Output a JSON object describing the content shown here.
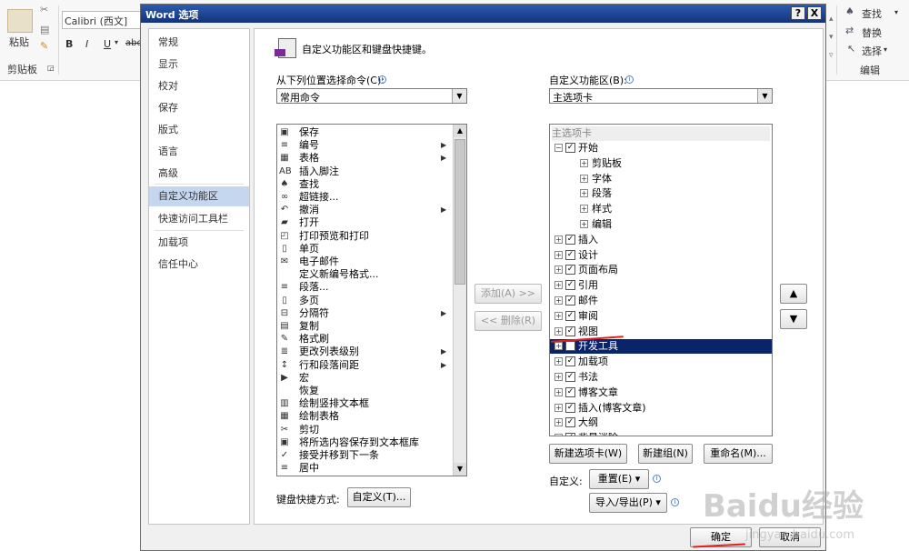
{
  "ribbon": {
    "paste_label": "粘贴",
    "clipboard_label": "剪贴板",
    "font_name": "Calibri (西文]",
    "bold": "B",
    "italic": "I",
    "underline": "U",
    "find_label": "查找",
    "replace_label": "替换",
    "select_label": "选择",
    "editing_label": "编辑"
  },
  "dialog": {
    "title": "Word 选项",
    "help_btn": "?",
    "close_btn": "X"
  },
  "nav": {
    "items": [
      "常规",
      "显示",
      "校对",
      "保存",
      "版式",
      "语言",
      "高级",
      "自定义功能区",
      "快速访问工具栏",
      "加载项",
      "信任中心"
    ],
    "selected": "自定义功能区"
  },
  "main": {
    "heading": "自定义功能区和键盘快捷键。",
    "left_label": "从下列位置选择命令(C):",
    "left_combo": "常用命令",
    "right_label": "自定义功能区(B):",
    "right_combo": "主选项卡",
    "commands": [
      {
        "icon": "▣",
        "label": "保存",
        "sub": ""
      },
      {
        "icon": "≡",
        "label": "编号",
        "sub": "▶"
      },
      {
        "icon": "▦",
        "label": "表格",
        "sub": "▶"
      },
      {
        "icon": "AB",
        "label": "插入脚注",
        "sub": ""
      },
      {
        "icon": "♠",
        "label": "查找",
        "sub": ""
      },
      {
        "icon": "∞",
        "label": "超链接...",
        "sub": ""
      },
      {
        "icon": "↶",
        "label": "撤消",
        "sub": "▶"
      },
      {
        "icon": "▰",
        "label": "打开",
        "sub": ""
      },
      {
        "icon": "◰",
        "label": "打印预览和打印",
        "sub": ""
      },
      {
        "icon": "▯",
        "label": "单页",
        "sub": ""
      },
      {
        "icon": "✉",
        "label": "电子邮件",
        "sub": ""
      },
      {
        "icon": "",
        "label": "定义新编号格式...",
        "sub": ""
      },
      {
        "icon": "≡",
        "label": "段落...",
        "sub": ""
      },
      {
        "icon": "▯",
        "label": "多页",
        "sub": ""
      },
      {
        "icon": "⊟",
        "label": "分隔符",
        "sub": "▶"
      },
      {
        "icon": "▤",
        "label": "复制",
        "sub": ""
      },
      {
        "icon": "✎",
        "label": "格式刷",
        "sub": ""
      },
      {
        "icon": "≣",
        "label": "更改列表级别",
        "sub": "▶"
      },
      {
        "icon": "↕",
        "label": "行和段落间距",
        "sub": "▶"
      },
      {
        "icon": "▶",
        "label": "宏",
        "sub": ""
      },
      {
        "icon": "",
        "label": "恢复",
        "sub": ""
      },
      {
        "icon": "▥",
        "label": "绘制竖排文本框",
        "sub": ""
      },
      {
        "icon": "▦",
        "label": "绘制表格",
        "sub": ""
      },
      {
        "icon": "✂",
        "label": "剪切",
        "sub": ""
      },
      {
        "icon": "▣",
        "label": "将所选内容保存到文本框库",
        "sub": ""
      },
      {
        "icon": "✓",
        "label": "接受并移到下一条",
        "sub": ""
      },
      {
        "icon": "≡",
        "label": "居中",
        "sub": ""
      }
    ],
    "add_btn": "添加(A) >>",
    "remove_btn": "<< 删除(R)",
    "tree_header": "主选项卡",
    "tree": [
      {
        "level": 0,
        "exp": "⊟",
        "check": true,
        "label": "开始",
        "selected": false
      },
      {
        "level": 1,
        "exp": "⊞",
        "check": false,
        "label": "剪贴板",
        "selected": false
      },
      {
        "level": 1,
        "exp": "⊞",
        "check": false,
        "label": "字体",
        "selected": false
      },
      {
        "level": 1,
        "exp": "⊞",
        "check": false,
        "label": "段落",
        "selected": false
      },
      {
        "level": 1,
        "exp": "⊞",
        "check": false,
        "label": "样式",
        "selected": false
      },
      {
        "level": 1,
        "exp": "⊞",
        "check": false,
        "label": "编辑",
        "selected": false
      },
      {
        "level": 0,
        "exp": "⊞",
        "check": true,
        "label": "插入",
        "selected": false
      },
      {
        "level": 0,
        "exp": "⊞",
        "check": true,
        "label": "设计",
        "selected": false
      },
      {
        "level": 0,
        "exp": "⊞",
        "check": true,
        "label": "页面布局",
        "selected": false
      },
      {
        "level": 0,
        "exp": "⊞",
        "check": true,
        "label": "引用",
        "selected": false
      },
      {
        "level": 0,
        "exp": "⊞",
        "check": true,
        "label": "邮件",
        "selected": false
      },
      {
        "level": 0,
        "exp": "⊞",
        "check": true,
        "label": "审阅",
        "selected": false
      },
      {
        "level": 0,
        "exp": "⊞",
        "check": true,
        "label": "视图",
        "selected": false
      },
      {
        "level": 0,
        "exp": "⊞",
        "check": true,
        "label": "开发工具",
        "selected": true
      },
      {
        "level": 0,
        "exp": "⊞",
        "check": true,
        "label": "加载项",
        "selected": false
      },
      {
        "level": 0,
        "exp": "⊞",
        "check": true,
        "label": "书法",
        "selected": false
      },
      {
        "level": 0,
        "exp": "⊞",
        "check": true,
        "label": "博客文章",
        "selected": false
      },
      {
        "level": 0,
        "exp": "⊞",
        "check": true,
        "label": "插入(博客文章)",
        "selected": false
      },
      {
        "level": 0,
        "exp": "⊞",
        "check": true,
        "label": "大纲",
        "selected": false
      },
      {
        "level": 0,
        "exp": "⊞",
        "check": true,
        "label": "背景消除",
        "selected": false
      }
    ],
    "new_tab_btn": "新建选项卡(W)",
    "new_group_btn": "新建组(N)",
    "rename_btn": "重命名(M)...",
    "customize_label": "自定义:",
    "reset_btn": "重置(E) ▾",
    "import_export_btn": "导入/导出(P) ▾",
    "keyboard_label": "键盘快捷方式:",
    "keyboard_btn": "自定义(T)..."
  },
  "footer": {
    "ok_btn": "确定",
    "cancel_btn": "取消"
  },
  "watermark": {
    "text": "Baidu经验",
    "url": "jingyan.baidu.com"
  },
  "colors": {
    "selection": "#0a246a",
    "nav_selection": "#c5d7ee",
    "annotation": "#e02020"
  }
}
